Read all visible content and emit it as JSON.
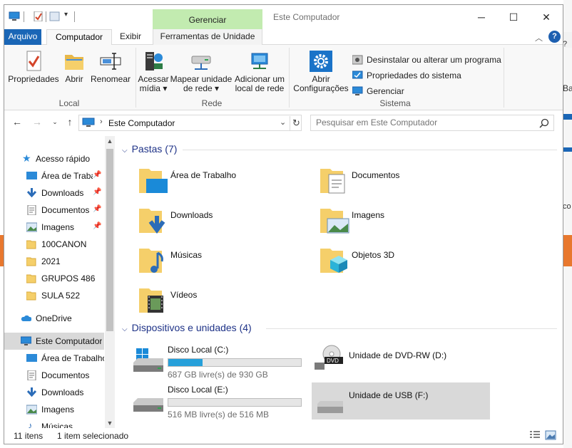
{
  "window": {
    "title": "Este Computador",
    "context_tab_header": "Gerenciar",
    "controls": {
      "minimize": "─",
      "maximize": "☐",
      "close": "✕"
    }
  },
  "ribbon_tabs": {
    "file": "Arquivo",
    "computer": "Computador",
    "view": "Exibir",
    "drive_tools": "Ferramentas de Unidade"
  },
  "ribbon": {
    "local": {
      "label": "Local",
      "properties": "Propriedades",
      "open": "Abrir",
      "rename": "Renomear"
    },
    "network": {
      "label": "Rede",
      "access_media_1": "Acessar",
      "access_media_2": "mídia ▾",
      "map_drive_1": "Mapear unidade",
      "map_drive_2": "de rede ▾",
      "add_location_1": "Adicionar um",
      "add_location_2": "local de rede"
    },
    "system": {
      "label": "Sistema",
      "open_settings_1": "Abrir",
      "open_settings_2": "Configurações",
      "uninstall": "Desinstalar ou alterar um programa",
      "system_properties": "Propriedades do sistema",
      "manage": "Gerenciar"
    }
  },
  "address": {
    "path": "Este Computador",
    "search_placeholder": "Pesquisar em Este Computador"
  },
  "nav": {
    "quick_access": "Acesso rápido",
    "pinned": [
      {
        "label": "Área de Traba",
        "icon": "desktop-icon"
      },
      {
        "label": "Downloads",
        "icon": "download-icon"
      },
      {
        "label": "Documentos",
        "icon": "document-icon"
      },
      {
        "label": "Imagens",
        "icon": "image-icon"
      }
    ],
    "folders": [
      "100CANON",
      "2021",
      "GRUPOS 486",
      "SULA 522"
    ],
    "onedrive": "OneDrive",
    "this_pc": "Este Computador",
    "pc_children": [
      "Área de Trabalho",
      "Documentos",
      "Downloads",
      "Imagens",
      "Músicas"
    ]
  },
  "content": {
    "folders_header": "Pastas (7)",
    "folders": [
      "Área de Trabalho",
      "Documentos",
      "Downloads",
      "Imagens",
      "Músicas",
      "Objetos 3D",
      "Vídeos"
    ],
    "devices_header": "Dispositivos e unidades (4)",
    "drives": [
      {
        "name": "Disco Local (C:)",
        "free": "687 GB livre(s) de 930 GB",
        "used_fraction": 0.26
      },
      {
        "name": "Unidade de DVD-RW (D:)"
      },
      {
        "name": "Disco Local (E:)",
        "free": "516 MB livre(s) de 516 MB",
        "used_fraction": 0.0
      },
      {
        "name": "Unidade de USB (F:)"
      }
    ]
  },
  "status": {
    "count": "11 itens",
    "selection": "1 item selecionado"
  },
  "background": {
    "text1": "Ba",
    "text2": "co"
  },
  "colors": {
    "accent": "#1a66b6",
    "context_tab": "#c2ebb0",
    "selection": "#cce8ff",
    "selected_drive": "#d9d9d9",
    "progress": "#26a0da",
    "section_header": "#1e3287"
  }
}
